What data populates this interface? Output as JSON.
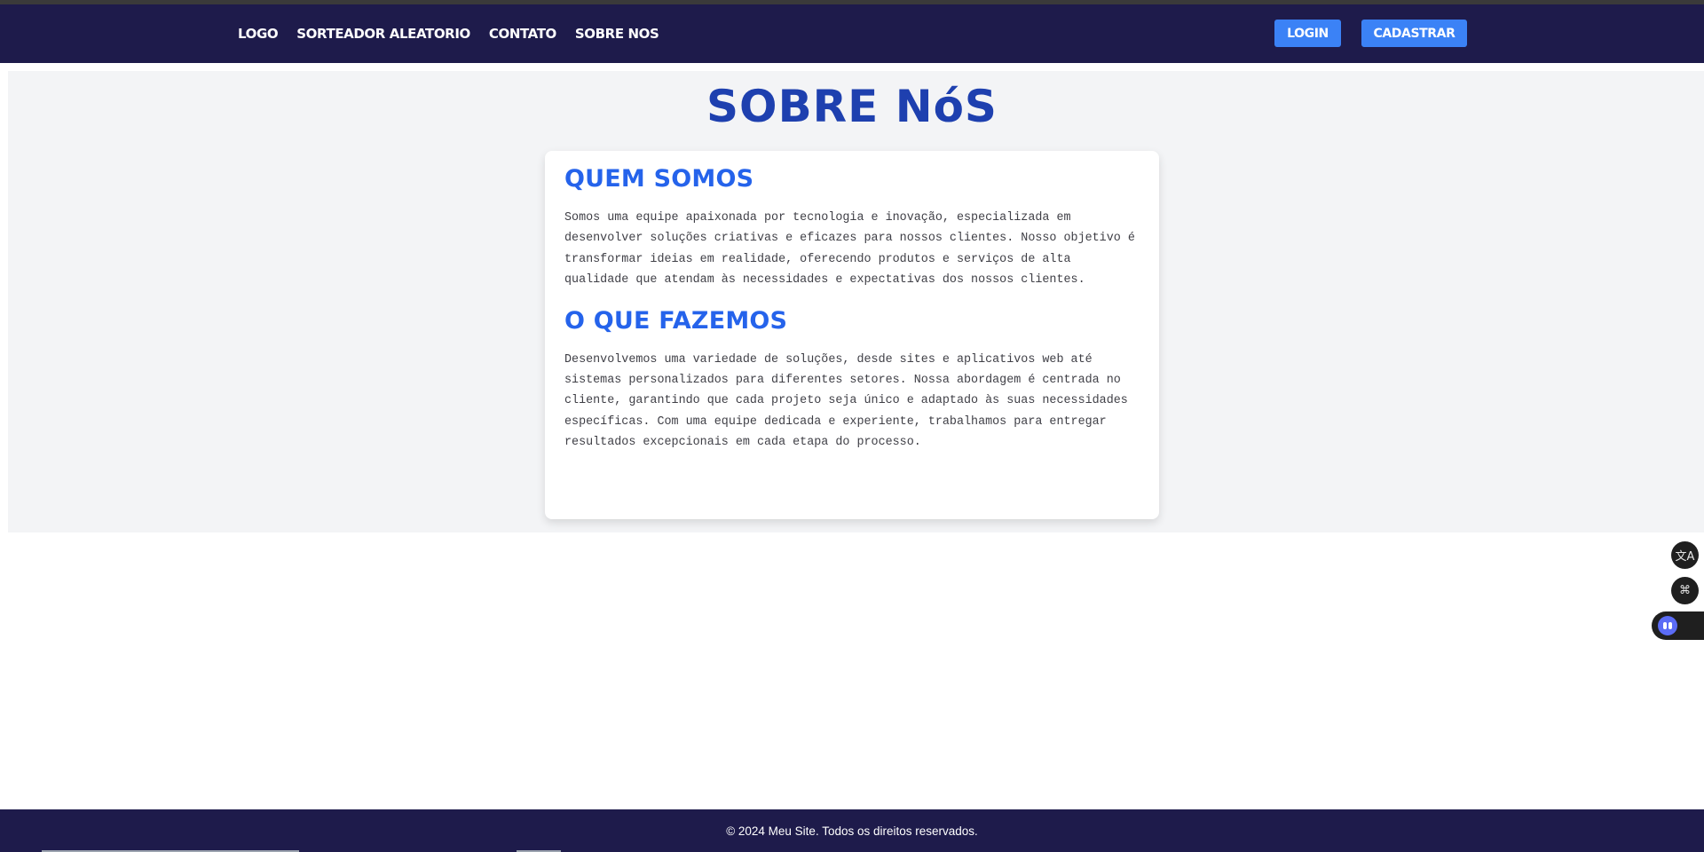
{
  "nav": {
    "links": [
      "LOGO",
      "SORTEADOR ALEATORIO",
      "CONTATO",
      "SOBRE NOS"
    ],
    "login_label": "LOGIN",
    "signup_label": "CADASTRAR"
  },
  "page": {
    "title": "SOBRE NóS"
  },
  "sections": [
    {
      "heading": "QUEM SOMOS",
      "text": "Somos uma equipe apaixonada por tecnologia e inovação, especializada em desenvolver soluções criativas e eficazes para nossos clientes. Nosso objetivo é transformar ideias em realidade, oferecendo produtos e serviços de alta qualidade que atendam às necessidades e expectativas dos nossos clientes."
    },
    {
      "heading": "O QUE FAZEMOS",
      "text": "Desenvolvemos uma variedade de soluções, desde sites e aplicativos web até sistemas personalizados para diferentes setores. Nossa abordagem é centrada no cliente, garantindo que cada projeto seja único e adaptado às suas necessidades específicas. Com uma equipe dedicada e experiente, trabalhamos para entregar resultados excepcionais em cada etapa do processo."
    }
  ],
  "floating": {
    "translate_icon": "translate-icon",
    "translate_glyph": "文A",
    "apps_icon": "apps-icon",
    "apps_glyph": "⌘",
    "assistant_icon": "assistant-icon"
  },
  "footer": {
    "text": "© 2024 Meu Site. Todos os direitos reservados."
  },
  "colors": {
    "navbar": "#1e1b4b",
    "button": "#3b82f6",
    "title": "#1e40af",
    "heading": "#2563eb",
    "section_bg": "#f3f4f6"
  }
}
